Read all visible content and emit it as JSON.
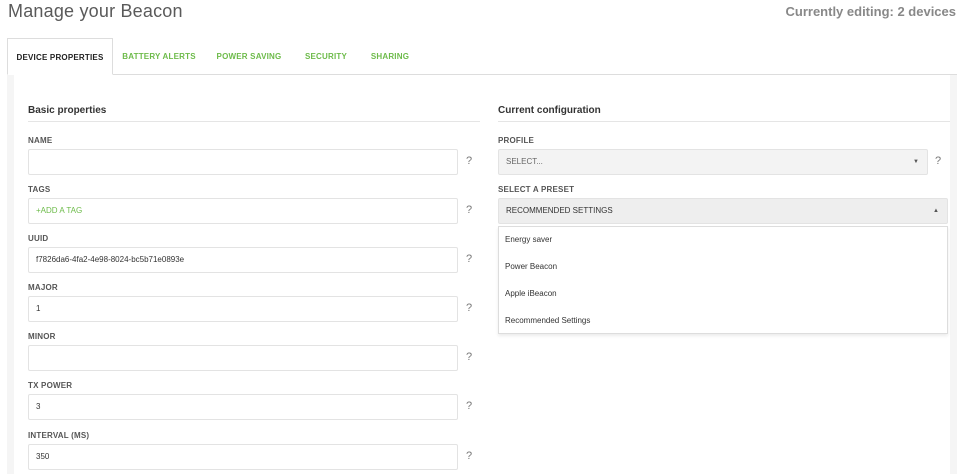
{
  "header": {
    "title": "Manage your Beacon",
    "editing_status": "Currently editing: 2 devices"
  },
  "tabs": [
    {
      "label": "DEVICE PROPERTIES",
      "active": true
    },
    {
      "label": "BATTERY ALERTS",
      "active": false
    },
    {
      "label": "POWER SAVING",
      "active": false
    },
    {
      "label": "SECURITY",
      "active": false
    },
    {
      "label": "SHARING",
      "active": false
    }
  ],
  "basic": {
    "title": "Basic properties",
    "fields": [
      {
        "label": "NAME",
        "value": ""
      },
      {
        "label": "TAGS",
        "value": "+ADD A TAG"
      },
      {
        "label": "UUID",
        "value": "f7826da6-4fa2-4e98-8024-bc5b71e0893e"
      },
      {
        "label": "MAJOR",
        "value": "1"
      },
      {
        "label": "MINOR",
        "value": ""
      },
      {
        "label": "TX POWER",
        "value": "3"
      },
      {
        "label": "INTERVAL (MS)",
        "value": "350"
      }
    ],
    "help": "?"
  },
  "config": {
    "title": "Current configuration",
    "profile_label": "PROFILE",
    "profile_value": "SELECT...",
    "preset_label": "SELECT A PRESET",
    "preset_value": "RECOMMENDED SETTINGS",
    "preset_options": [
      "Energy saver",
      "Power Beacon",
      "Apple iBeacon",
      "Recommended Settings"
    ],
    "help": "?"
  },
  "colors": {
    "accent": "#6dbb4a",
    "panel_bg": "#f5f5f5"
  }
}
